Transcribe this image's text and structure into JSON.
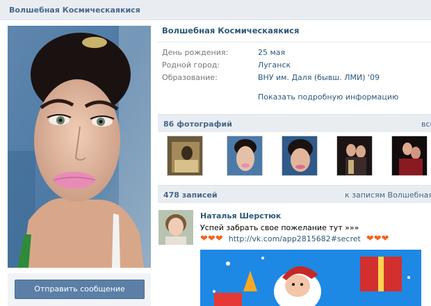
{
  "header": {
    "title": "Волшебная Космическаякися"
  },
  "profile": {
    "name": "Волшебная Космическаякися",
    "info": [
      {
        "label": "День рождения:",
        "value": "25 мая"
      },
      {
        "label": "Родной город:",
        "value": "Луганск"
      },
      {
        "label": "Образование:",
        "value": "ВНУ им. Даля (бывш. ЛМИ) '09"
      }
    ],
    "show_more": "Показать подробную информацию"
  },
  "actions": {
    "send_message": "Отправить сообщение"
  },
  "photos": {
    "title": "86 фотографий",
    "link": "все"
  },
  "wall": {
    "title": "478 записей",
    "link": "к записям Волшебная"
  },
  "post": {
    "author": "Наталья Шерстюк",
    "text": "Успей забрать свое пожелание тут »»»",
    "link": "http://vk.com/app2815682#secret",
    "heart": "❤"
  },
  "colors": {
    "accent": "#45688e",
    "link": "#2b587a",
    "button": "#5b7fa6",
    "header_bg": "#e9edf1",
    "heart": "#f26522"
  }
}
